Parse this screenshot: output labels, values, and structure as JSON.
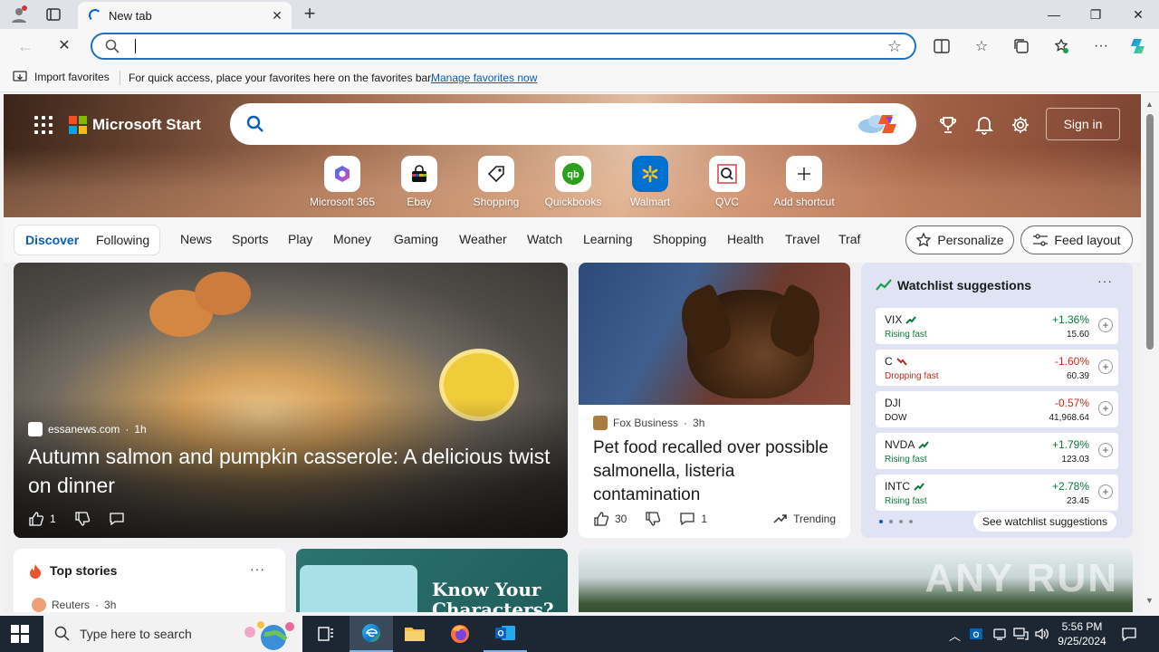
{
  "browser": {
    "tab_title": "New tab",
    "favorites_bar": {
      "import_label": "Import favorites",
      "message": "For quick access, place your favorites here on the favorites bar.",
      "manage_link": "Manage favorites now"
    }
  },
  "start": {
    "brand": "Microsoft Start",
    "sign_in": "Sign in",
    "shortcuts": [
      {
        "label": "Microsoft 365",
        "icon": "microsoft365-icon"
      },
      {
        "label": "Ebay",
        "icon": "ebay-icon"
      },
      {
        "label": "Shopping",
        "icon": "shopping-tag-icon"
      },
      {
        "label": "Quickbooks",
        "icon": "quickbooks-icon"
      },
      {
        "label": "Walmart",
        "icon": "walmart-icon"
      },
      {
        "label": "QVC",
        "icon": "qvc-icon"
      },
      {
        "label": "Add shortcut",
        "icon": "plus-icon"
      }
    ],
    "feed_tabs": {
      "discover": "Discover",
      "following": "Following"
    },
    "nav": [
      "News",
      "Sports",
      "Play",
      "Money",
      "Gaming",
      "Weather",
      "Watch",
      "Learning",
      "Shopping",
      "Health",
      "Travel",
      "Traf"
    ],
    "personalize": "Personalize",
    "feed_layout": "Feed layout"
  },
  "feed": {
    "main": {
      "source": "essanews.com",
      "age": "1h",
      "headline": "Autumn salmon and pumpkin casserole: A delicious twist on dinner",
      "likes": "1"
    },
    "secondary": {
      "source": "Fox Business",
      "age": "3h",
      "headline": "Pet food recalled over possible salmonella, listeria contamination",
      "likes": "30",
      "comments": "1",
      "trending": "Trending"
    },
    "watchlist": {
      "title": "Watchlist suggestions",
      "see_all": "See watchlist suggestions",
      "stocks": [
        {
          "symbol": "VIX",
          "sub": "Rising fast",
          "change": "+1.36%",
          "price": "15.60",
          "direction": "up"
        },
        {
          "symbol": "C",
          "sub": "Dropping fast",
          "change": "-1.60%",
          "price": "60.39",
          "direction": "down"
        },
        {
          "symbol": "DJI",
          "sub": "DOW",
          "change": "-0.57%",
          "price": "41,968.64",
          "direction": "neutral"
        },
        {
          "symbol": "NVDA",
          "sub": "Rising fast",
          "change": "+1.79%",
          "price": "123.03",
          "direction": "up"
        },
        {
          "symbol": "INTC",
          "sub": "Rising fast",
          "change": "+2.78%",
          "price": "23.45",
          "direction": "up"
        }
      ]
    },
    "top_stories": {
      "title": "Top stories",
      "source": "Reuters",
      "age": "3h"
    },
    "promo": {
      "headline": "Know Your Characters?"
    },
    "watermark": "ANY RUN"
  },
  "taskbar": {
    "search_placeholder": "Type here to search",
    "time": "5:56 PM",
    "date": "9/25/2024"
  },
  "colors": {
    "accent": "#0a5fb4",
    "up": "#0a7a3c",
    "down": "#c42b1c"
  }
}
